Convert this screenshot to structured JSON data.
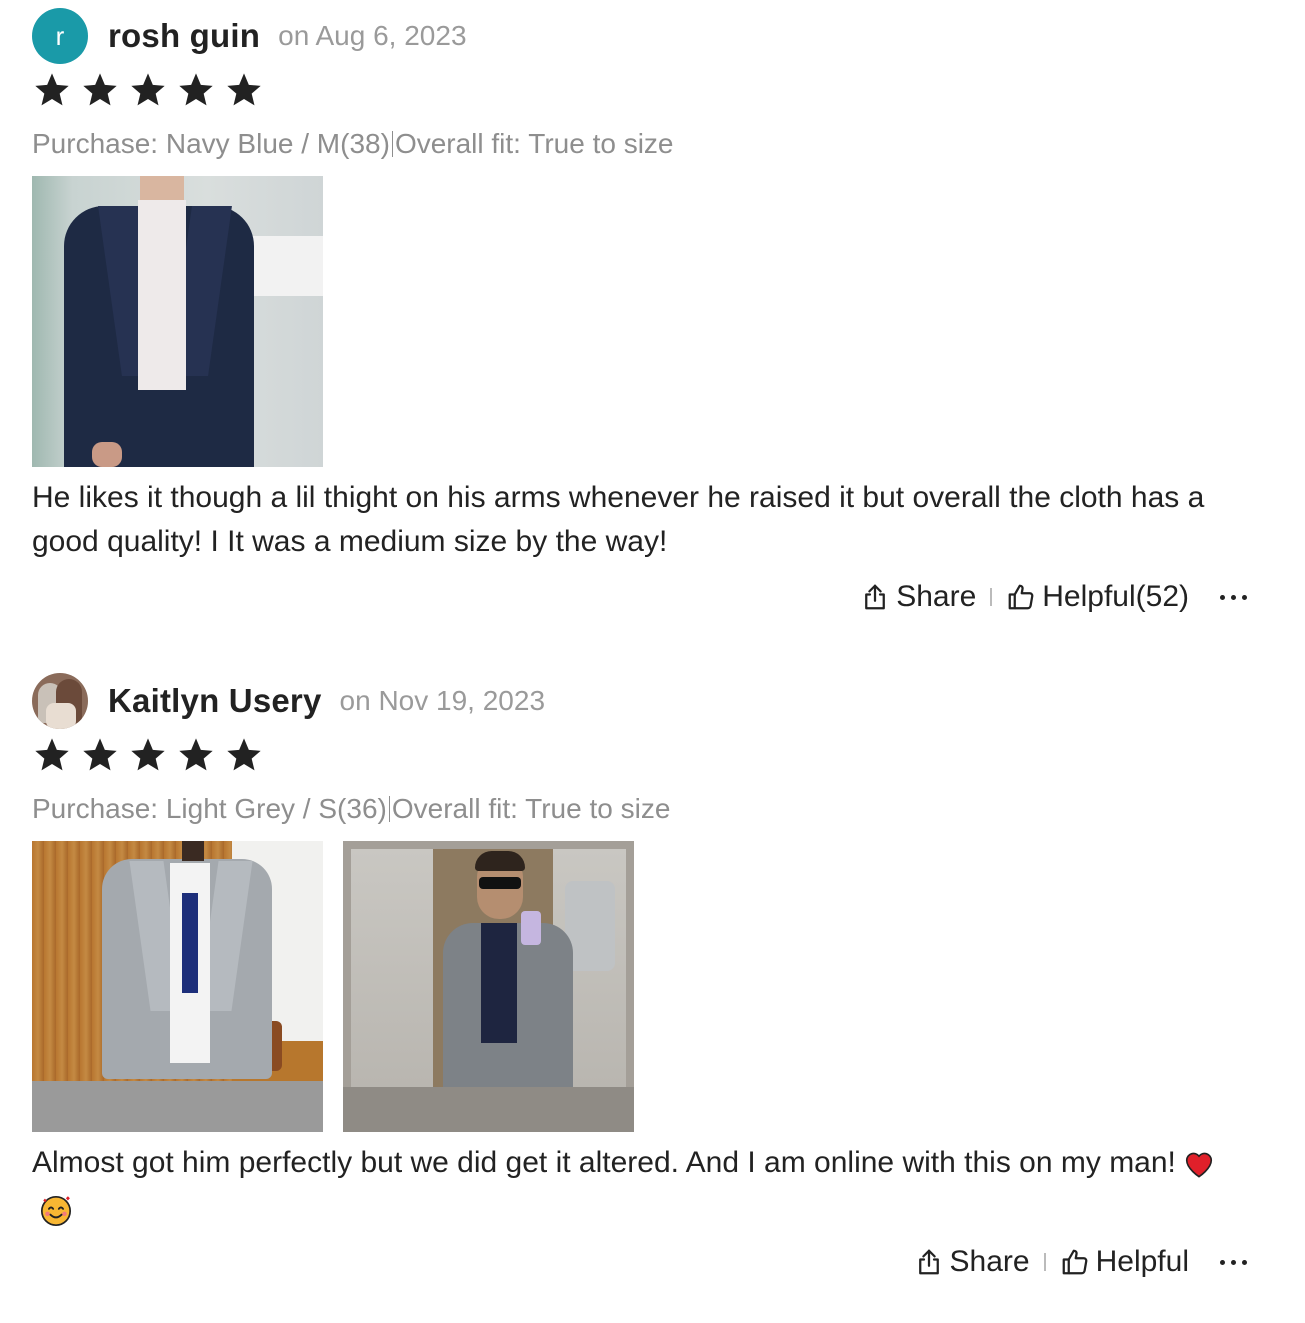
{
  "reviews": [
    {
      "avatar_letter": "r",
      "name": "rosh guin",
      "date": "on Aug 6, 2023",
      "rating": 5,
      "purchase_label": "Purchase:",
      "purchase_variant": "Navy Blue / M(38)",
      "fit_label": "Overall fit:",
      "fit_value": "True to size",
      "text": "He likes it though a lil thight on his arms whenever he raised it but overall the cloth has a good quality! I It was a medium size by the way!",
      "share_label": "Share",
      "helpful_label": "Helpful(52)"
    },
    {
      "avatar_letter": "",
      "name": "Kaitlyn Usery",
      "date": "on Nov 19, 2023",
      "rating": 5,
      "purchase_label": "Purchase:",
      "purchase_variant": "Light Grey / S(36)",
      "fit_label": "Overall fit:",
      "fit_value": "True to size",
      "text": "Almost got him perfectly but we did get it altered. And I am online with this on my man!",
      "share_label": "Share",
      "helpful_label": "Helpful"
    }
  ],
  "icons": {
    "star": "star-icon",
    "share": "share-icon",
    "helpful": "thumbs-up-icon",
    "more": "more-dots-icon",
    "emoji_1": "red-heart-emoji",
    "emoji_2": "smiling-face-with-hearts-emoji"
  },
  "colors": {
    "avatar_bg": "#1a9aa8",
    "star": "#222222",
    "muted_text": "#8e8e8e",
    "date_text": "#9a9a9a"
  }
}
